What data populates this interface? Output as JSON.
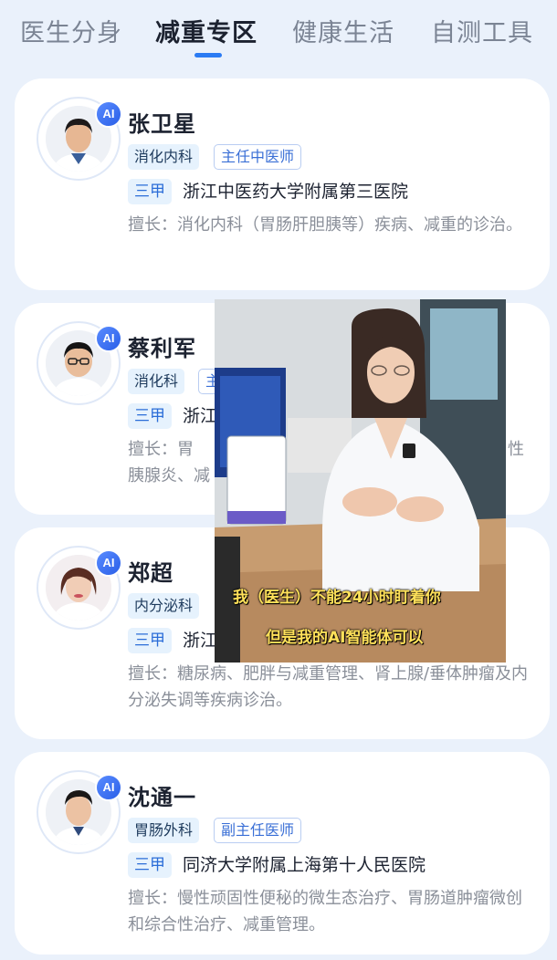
{
  "tabs": [
    {
      "label": "医生分身",
      "active": false
    },
    {
      "label": "减重专区",
      "active": true
    },
    {
      "label": "健康生活",
      "active": false
    },
    {
      "label": "自测工具",
      "active": false
    }
  ],
  "accent_color": "#2b7bf3",
  "ai_badge": "AI",
  "doctors": [
    {
      "name": "张卫星",
      "dept": "消化内科",
      "title": "主任中医师",
      "level": "三甲",
      "hospital": "浙江中医药大学附属第三医院",
      "expertise": "擅长：消化内科（胃肠肝胆胰等）疾病、减重的诊治。"
    },
    {
      "name": "蔡利军",
      "dept": "消化科",
      "title": "主",
      "level": "三甲",
      "hospital": "浙江",
      "expertise": "擅长：胃",
      "expertise_tail": "性",
      "expertise_line2": "胰腺炎、减"
    },
    {
      "name": "郑超",
      "dept": "内分泌科",
      "title": "",
      "level": "三甲",
      "hospital": "浙江",
      "expertise": "擅长：糖尿病、肥胖与减重管理、肾上腺/垂体肿瘤及内分泌失调等疾病诊治。"
    },
    {
      "name": "沈通一",
      "dept": "胃肠外科",
      "title": "副主任医师",
      "level": "三甲",
      "hospital": "同济大学附属上海第十人民医院",
      "expertise": "擅长：慢性顽固性便秘的微生态治疗、胃肠道肿瘤微创和综合性治疗、减重管理。"
    }
  ],
  "video_overlay": {
    "subtitle_line1": "我（医生）不能24小时盯着你",
    "subtitle_line2": "但是我的AI智能体可以"
  }
}
